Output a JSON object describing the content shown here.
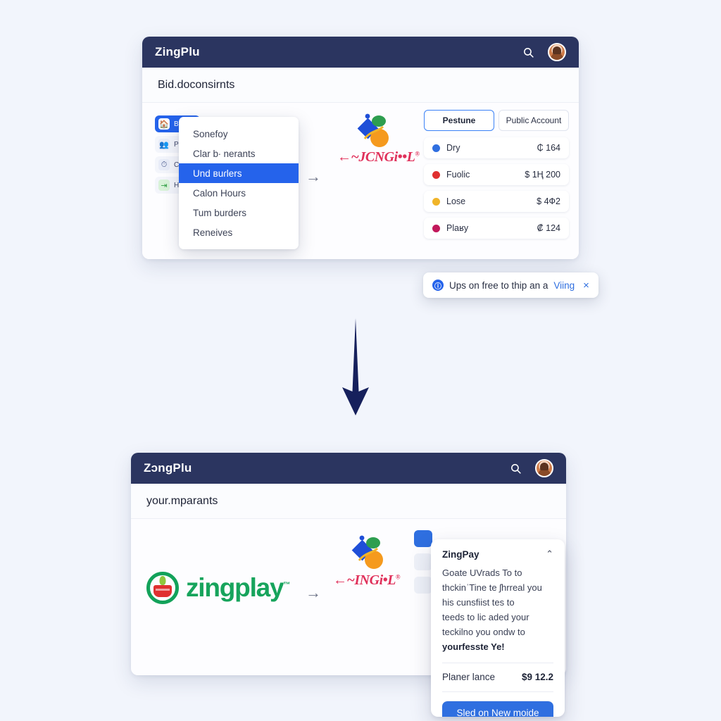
{
  "background_color": "#f2f5fc",
  "card_one": {
    "appbar": {
      "title": "ZingPlu",
      "search_icon": "search-icon",
      "avatar": "user-avatar"
    },
    "subheader": {
      "text": "Bid.doconsirnts"
    },
    "rail": [
      {
        "icon": "home-icon",
        "label": "B",
        "active": true
      },
      {
        "icon": "people-icon",
        "label": "P",
        "active": false
      },
      {
        "icon": "clock-icon",
        "label": "C",
        "active": false
      },
      {
        "icon": "exit-icon",
        "label": "H",
        "active": false
      }
    ],
    "menu": {
      "items": [
        {
          "label": "Sonefoy",
          "selected": false
        },
        {
          "label": "Clar b∙ nerants",
          "selected": false
        },
        {
          "label": "Und вuɾlers",
          "selected": true
        },
        {
          "label": "Calon Hours",
          "selected": false
        },
        {
          "label": "Tum burders",
          "selected": false
        },
        {
          "label": "Reneives",
          "selected": false
        }
      ]
    },
    "arrow": "→",
    "brand": {
      "wordmark": "←~JCNGi••L",
      "registered": "®"
    },
    "tabs": [
      {
        "label": "Pestune",
        "active": true
      },
      {
        "label": "Public Account",
        "active": false
      }
    ],
    "rows": [
      {
        "label": "Dry",
        "amount": "₵ 164",
        "color": "#2f6fe0"
      },
      {
        "label": "Fuolic",
        "amount": "$ 1Ң 200",
        "color": "#e03030"
      },
      {
        "label": "Lose",
        "amount": "$ 4Ф2",
        "color": "#f0b429"
      },
      {
        "label": "Plaʁy",
        "amount": "₡ 124",
        "color": "#c2185b"
      }
    ],
    "toast": {
      "badge": "ⓘ",
      "text": "Ups on free to thip an a ",
      "link": "Viing",
      "close": "×"
    }
  },
  "flow_arrow": "down-arrow",
  "card_two": {
    "appbar": {
      "title": "ZɔngPlu",
      "search_icon": "search-icon",
      "avatar": "user-avatar"
    },
    "subheader": {
      "text": "your.mparants"
    },
    "logo": {
      "wordmark": "zingplay",
      "tm": "™"
    },
    "arrow": "→",
    "brand": {
      "wordmark": "←~INGi•L",
      "registered": "®"
    },
    "popover": {
      "title": "ZingPay",
      "chevron": "⌃",
      "lines": [
        "Goate UVrads To to",
        "thckinˈTine te ʃhrreal you",
        "his cunsfiist tes to",
        "teeds to lic aded your",
        "teckilno you ondw to"
      ],
      "bold_line": "yourfesste Ye!",
      "balance_label": "Planer lance",
      "balance_amount": "$9 12.2",
      "cta_label": "Sled on New moide"
    }
  }
}
